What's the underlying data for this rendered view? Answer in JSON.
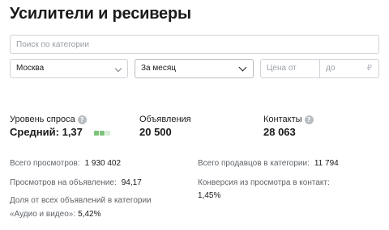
{
  "page": {
    "title": "Усилители и ресиверы"
  },
  "filters": {
    "search_placeholder": "Поиск по категории",
    "city": "Москва",
    "period": "За месяц",
    "price_from_placeholder": "Цена от",
    "price_to_placeholder": "до",
    "currency": "₽"
  },
  "stats": {
    "demand": {
      "label": "Уровень спроса",
      "value": "Средний: 1,37",
      "level_filled": 2,
      "level_total": 3,
      "color_filled": "#7cc47a",
      "color_empty": "#d9ecd6"
    },
    "ads": {
      "label": "Объявления",
      "value": "20 500"
    },
    "contacts": {
      "label": "Контакты",
      "value": "28 063"
    },
    "help_glyph": "?"
  },
  "details": {
    "total_views": {
      "label": "Всего просмотров:",
      "value": "1 930 402"
    },
    "views_per_ad": {
      "label": "Просмотров на объявление:",
      "value": "94,17"
    },
    "share_line1": "Доля от всех объявлений в категории",
    "share_line2": "«Аудио и видео»:",
    "share_value": "5,42%",
    "sellers": {
      "label": "Всего продавцов в категории:",
      "value": "11 794"
    },
    "conversion_line1": "Конверсия из просмотра в контакт:",
    "conversion_value": "1,45%"
  }
}
